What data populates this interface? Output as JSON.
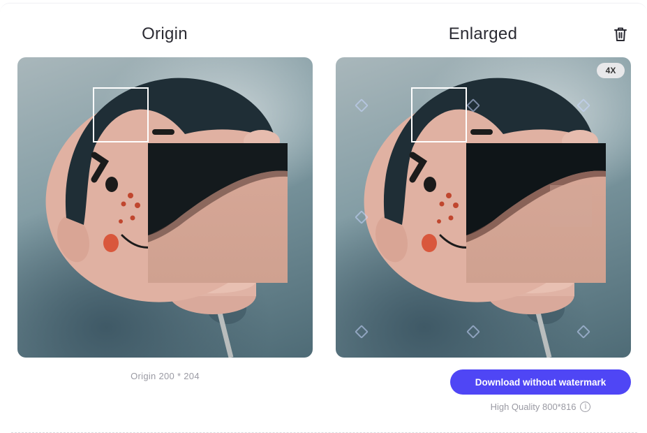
{
  "origin": {
    "title": "Origin",
    "size_text": "Origin 200 * 204"
  },
  "enlarged": {
    "title": "Enlarged",
    "scale_badge": "4X",
    "download_label": "Download without watermark",
    "quality_text": "High Quality 800*816",
    "info_icon": "info-icon",
    "delete_icon": "trash-icon"
  },
  "colors": {
    "accent": "#4f46f5",
    "muted_text": "#9a9aa3",
    "title_text": "#2b2b33",
    "badge_bg": "#e8e8ea"
  }
}
